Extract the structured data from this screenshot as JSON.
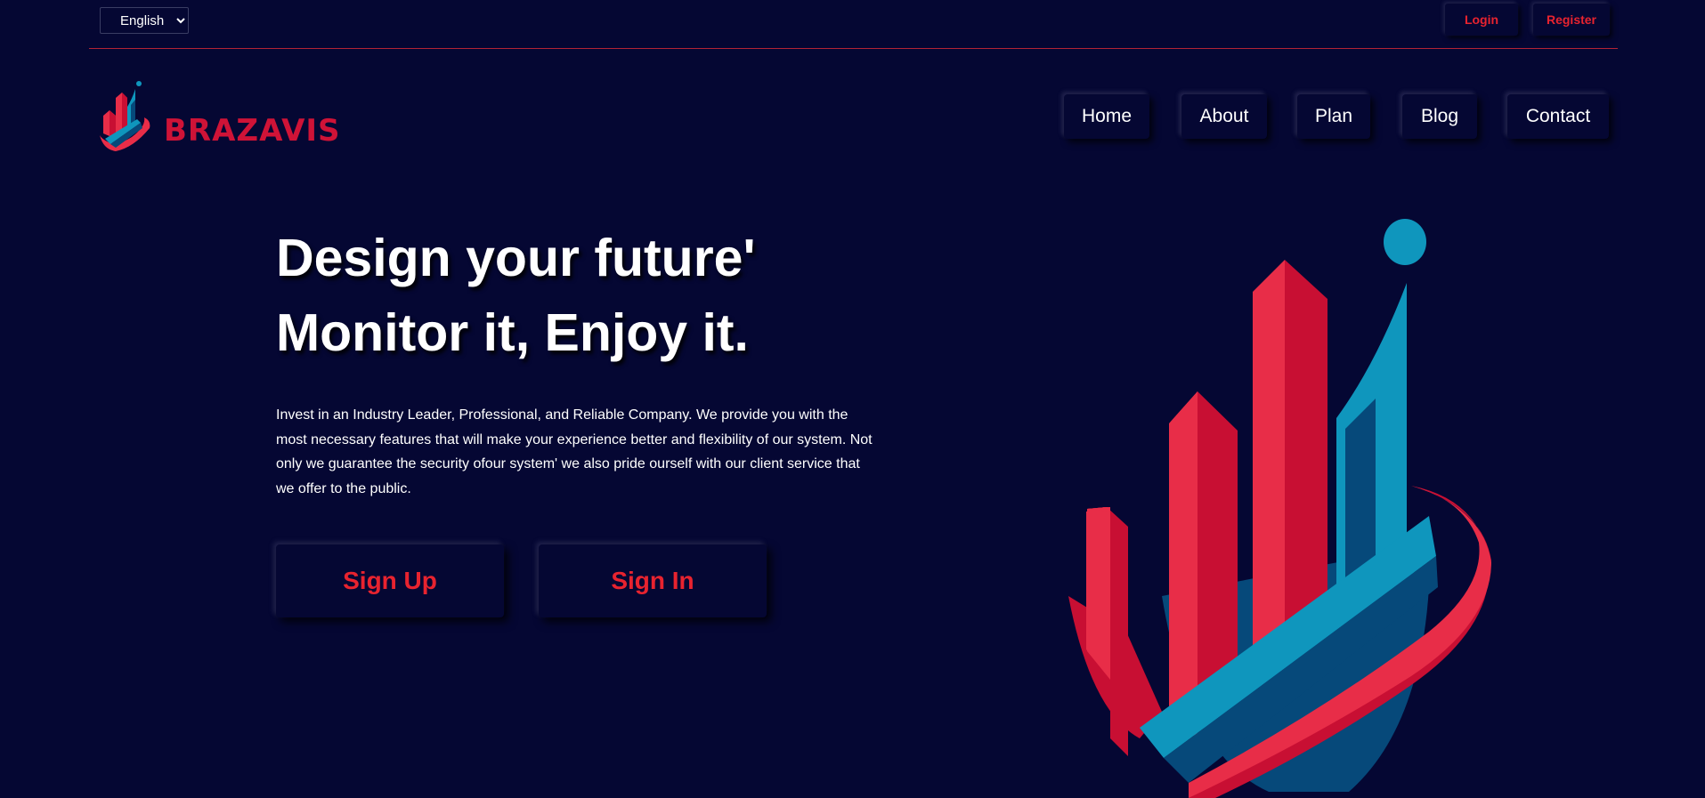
{
  "topbar": {
    "language": {
      "selected": "English",
      "options": [
        "English"
      ]
    },
    "login_label": "Login",
    "register_label": "Register"
  },
  "brand": {
    "name": "BRAZAVIS"
  },
  "nav": {
    "items": [
      {
        "label": "Home"
      },
      {
        "label": "About"
      },
      {
        "label": "Plan"
      },
      {
        "label": "Blog"
      },
      {
        "label": "Contact"
      }
    ]
  },
  "hero": {
    "headline_line1": "Design your future'",
    "headline_line2": "Monitor it, Enjoy it.",
    "description": "Invest in an Industry Leader, Professional, and Reliable Company. We provide you with the most necessary features that will make your experience better and flexibility of our system. Not only we guarantee the security ofour system' we also pride ourself with our client service that we offer to the public.",
    "signup_label": "Sign Up",
    "signin_label": "Sign In"
  },
  "colors": {
    "background": "#050733",
    "accent_red": "#e8232f",
    "brand_crimson": "#cf1337",
    "brand_blue": "#0f96bd",
    "brand_navy": "#06497a",
    "divider": "#b32335"
  },
  "icons": [
    "brazavis-logo-icon",
    "hero-bar-chart-graphic"
  ]
}
